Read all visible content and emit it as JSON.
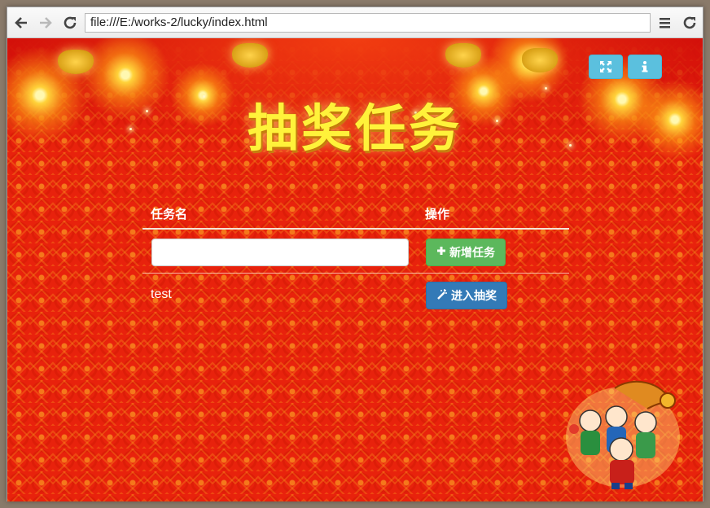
{
  "browser": {
    "back_icon": "arrow-left-icon",
    "forward_icon": "arrow-right-icon",
    "reload_icon": "reload-icon",
    "address": "file:///E:/works-2/lucky/index.html",
    "menu_icon": "hamburger-menu-icon",
    "refresh_icon": "refresh-icon"
  },
  "page": {
    "title": "抽奖任务",
    "fullscreen_icon": "fullscreen-icon",
    "info_icon": "info-icon"
  },
  "table": {
    "headers": {
      "name": "任务名",
      "action": "操作"
    },
    "new_task": {
      "input_value": "",
      "add_button": "新增任务",
      "add_icon": "plus-icon"
    },
    "rows": [
      {
        "name": "test",
        "action_button": "进入抽奖",
        "action_icon": "magic-wand-icon"
      }
    ]
  },
  "colors": {
    "background_red": "#e8220c",
    "title_yellow": "#fff23a",
    "info_button": "#5bc0de",
    "success_button": "#5cb85c",
    "primary_button": "#337ab7"
  }
}
